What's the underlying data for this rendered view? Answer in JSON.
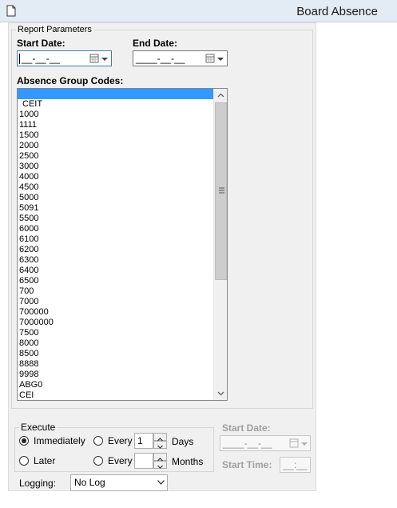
{
  "window": {
    "title": "Board Absence"
  },
  "report_parameters": {
    "legend": "Report Parameters",
    "start_date": {
      "label": "Start Date:",
      "value": "__-__-__"
    },
    "end_date": {
      "label": "End Date:",
      "value": "____-__-__"
    },
    "absence_group_codes": {
      "label": "Absence Group Codes:",
      "items": [
        "",
        "CEIT",
        "1000",
        "1111",
        "1500",
        "2000",
        "2500",
        "3000",
        "4000",
        "4500",
        "5000",
        "5091",
        "5500",
        "6000",
        "6100",
        "6200",
        "6300",
        "6400",
        "6500",
        "700",
        "7000",
        "700000",
        "7000000",
        "7500",
        "8000",
        "8500",
        "8888",
        "9998",
        "ABG0",
        "CEI"
      ],
      "selected_index": 0
    }
  },
  "execute": {
    "legend": "Execute",
    "immediately_label": "Immediately",
    "later_label": "Later",
    "every_label": "Every",
    "every_days_value": "1",
    "days_label": "Days",
    "every_months_value": "",
    "months_label": "Months",
    "selected": "Immediately",
    "start_date": {
      "label": "Start Date:",
      "value": "____-__-__"
    },
    "start_time": {
      "label": "Start Time:",
      "value": "__:__"
    }
  },
  "logging": {
    "label": "Logging:",
    "value": "No Log"
  },
  "colors": {
    "selection": "#3399ff",
    "titlebar": "#e3ebf5",
    "panel": "#f0f0f0"
  }
}
